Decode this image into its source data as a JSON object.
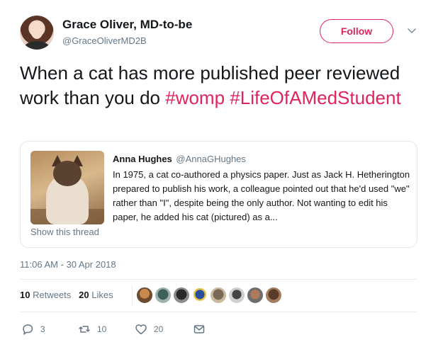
{
  "author": {
    "name": "Grace Oliver, MD-to-be",
    "handle": "@GraceOliverMD2B"
  },
  "follow_label": "Follow",
  "tweet": {
    "text_main": "When a cat has more published peer reviewed work than you do ",
    "hashtag1": "#womp",
    "hashtag2": "#LifeOfAMedStudent"
  },
  "quote": {
    "name": "Anna Hughes",
    "handle": "@AnnaGHughes",
    "body": "In 1975, a cat co-authored a physics paper. Just as Jack H. Hetherington prepared to publish his work, a colleague pointed out that he'd used \"we\" rather than \"I\", despite being the only author. Not wanting to edit his paper, he added his cat (pictured) as a...",
    "show_thread": "Show this thread"
  },
  "timestamp": "11:06 AM - 30 Apr 2018",
  "stats": {
    "retweets_count": "10",
    "retweets_label": "Retweets",
    "likes_count": "20",
    "likes_label": "Likes"
  },
  "actions": {
    "replies": "3",
    "retweets": "10",
    "likes": "20"
  },
  "colors": {
    "accent": "#e0245e",
    "secondary_text": "#657786",
    "border": "#e1e8ed"
  }
}
